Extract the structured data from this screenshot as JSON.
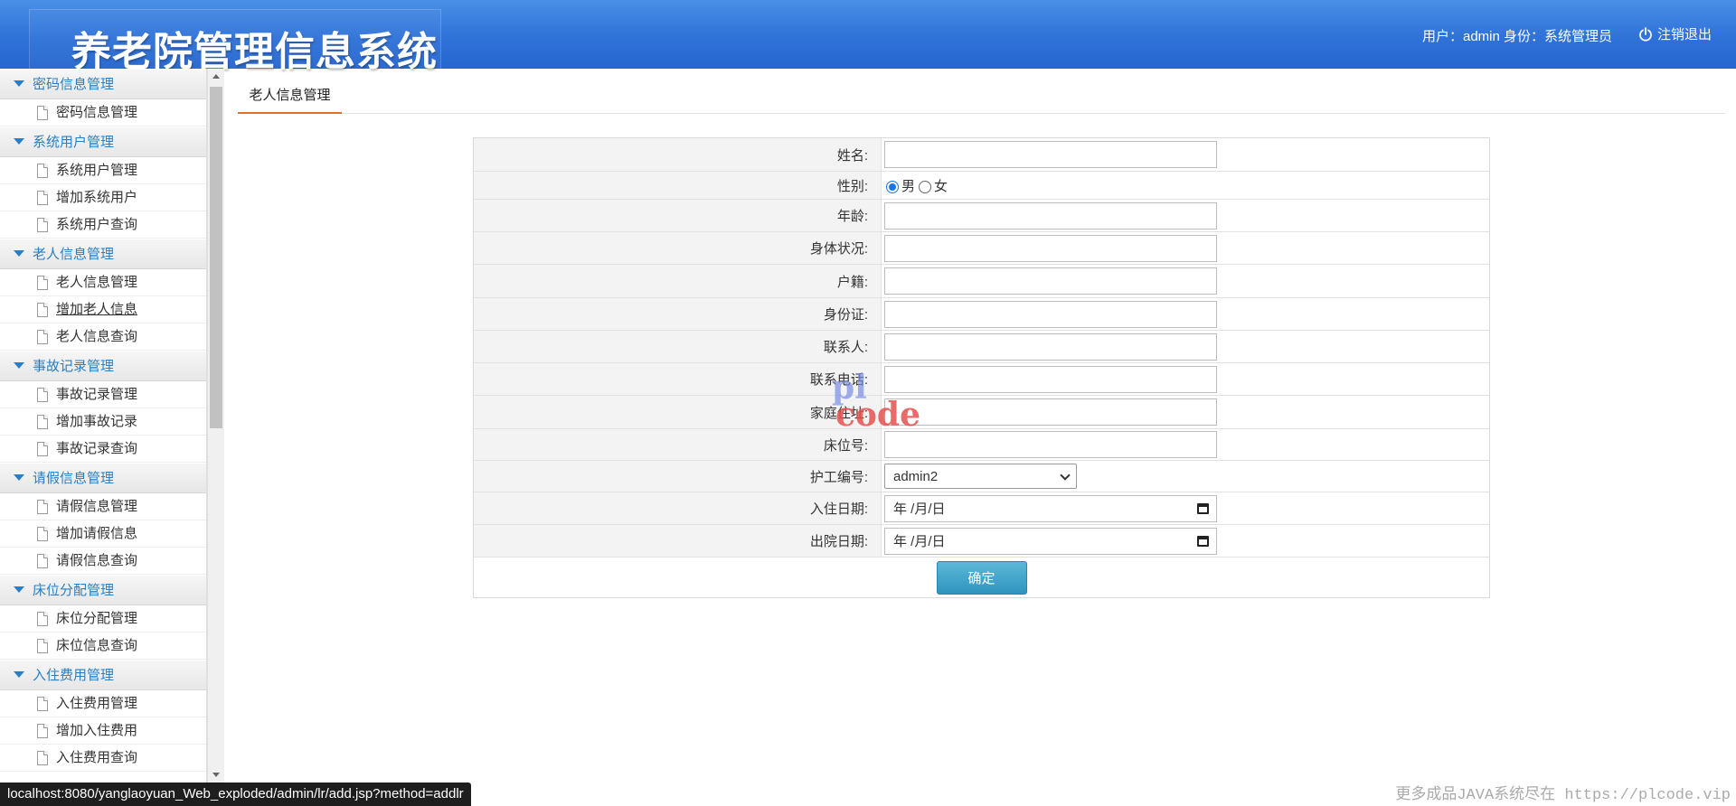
{
  "header": {
    "title": "养老院管理信息系统",
    "user_info": "用户：admin 身份：系统管理员",
    "logout_label": "注销退出"
  },
  "sidebar": {
    "groups": [
      {
        "title": "密码信息管理",
        "items": [
          "密码信息管理"
        ]
      },
      {
        "title": "系统用户管理",
        "items": [
          "系统用户管理",
          "增加系统用户",
          "系统用户查询"
        ]
      },
      {
        "title": "老人信息管理",
        "items": [
          "老人信息管理",
          "增加老人信息",
          "老人信息查询"
        ]
      },
      {
        "title": "事故记录管理",
        "items": [
          "事故记录管理",
          "增加事故记录",
          "事故记录查询"
        ]
      },
      {
        "title": "请假信息管理",
        "items": [
          "请假信息管理",
          "增加请假信息",
          "请假信息查询"
        ]
      },
      {
        "title": "床位分配管理",
        "items": [
          "床位分配管理",
          "床位信息查询"
        ]
      },
      {
        "title": "入住费用管理",
        "items": [
          "入住费用管理",
          "增加入住费用",
          "入住费用查询"
        ]
      }
    ]
  },
  "main": {
    "tab_label": "老人信息管理",
    "form": {
      "name_label": "姓名:",
      "gender_label": "性别:",
      "gender_male": "男",
      "gender_female": "女",
      "age_label": "年龄:",
      "health_label": "身体状况:",
      "household_label": "户籍:",
      "idcard_label": "身份证:",
      "contact_label": "联系人:",
      "phone_label": "联系电话:",
      "address_label": "家庭住址:",
      "bed_label": "床位号:",
      "nurse_label": "护工编号:",
      "nurse_selected": "admin2",
      "checkin_label": "入住日期:",
      "checkin_value": "年 /月/日",
      "checkout_label": "出院日期:",
      "checkout_value": "年 /月/日",
      "submit_label": "确定"
    }
  },
  "watermark": {
    "line1": "pl",
    "line2": "code"
  },
  "status_url": "localhost:8080/yanglaoyuan_Web_exploded/admin/lr/add.jsp?method=addlr",
  "footer_note": "更多成品JAVA系统尽在 https://plcode.vip"
}
